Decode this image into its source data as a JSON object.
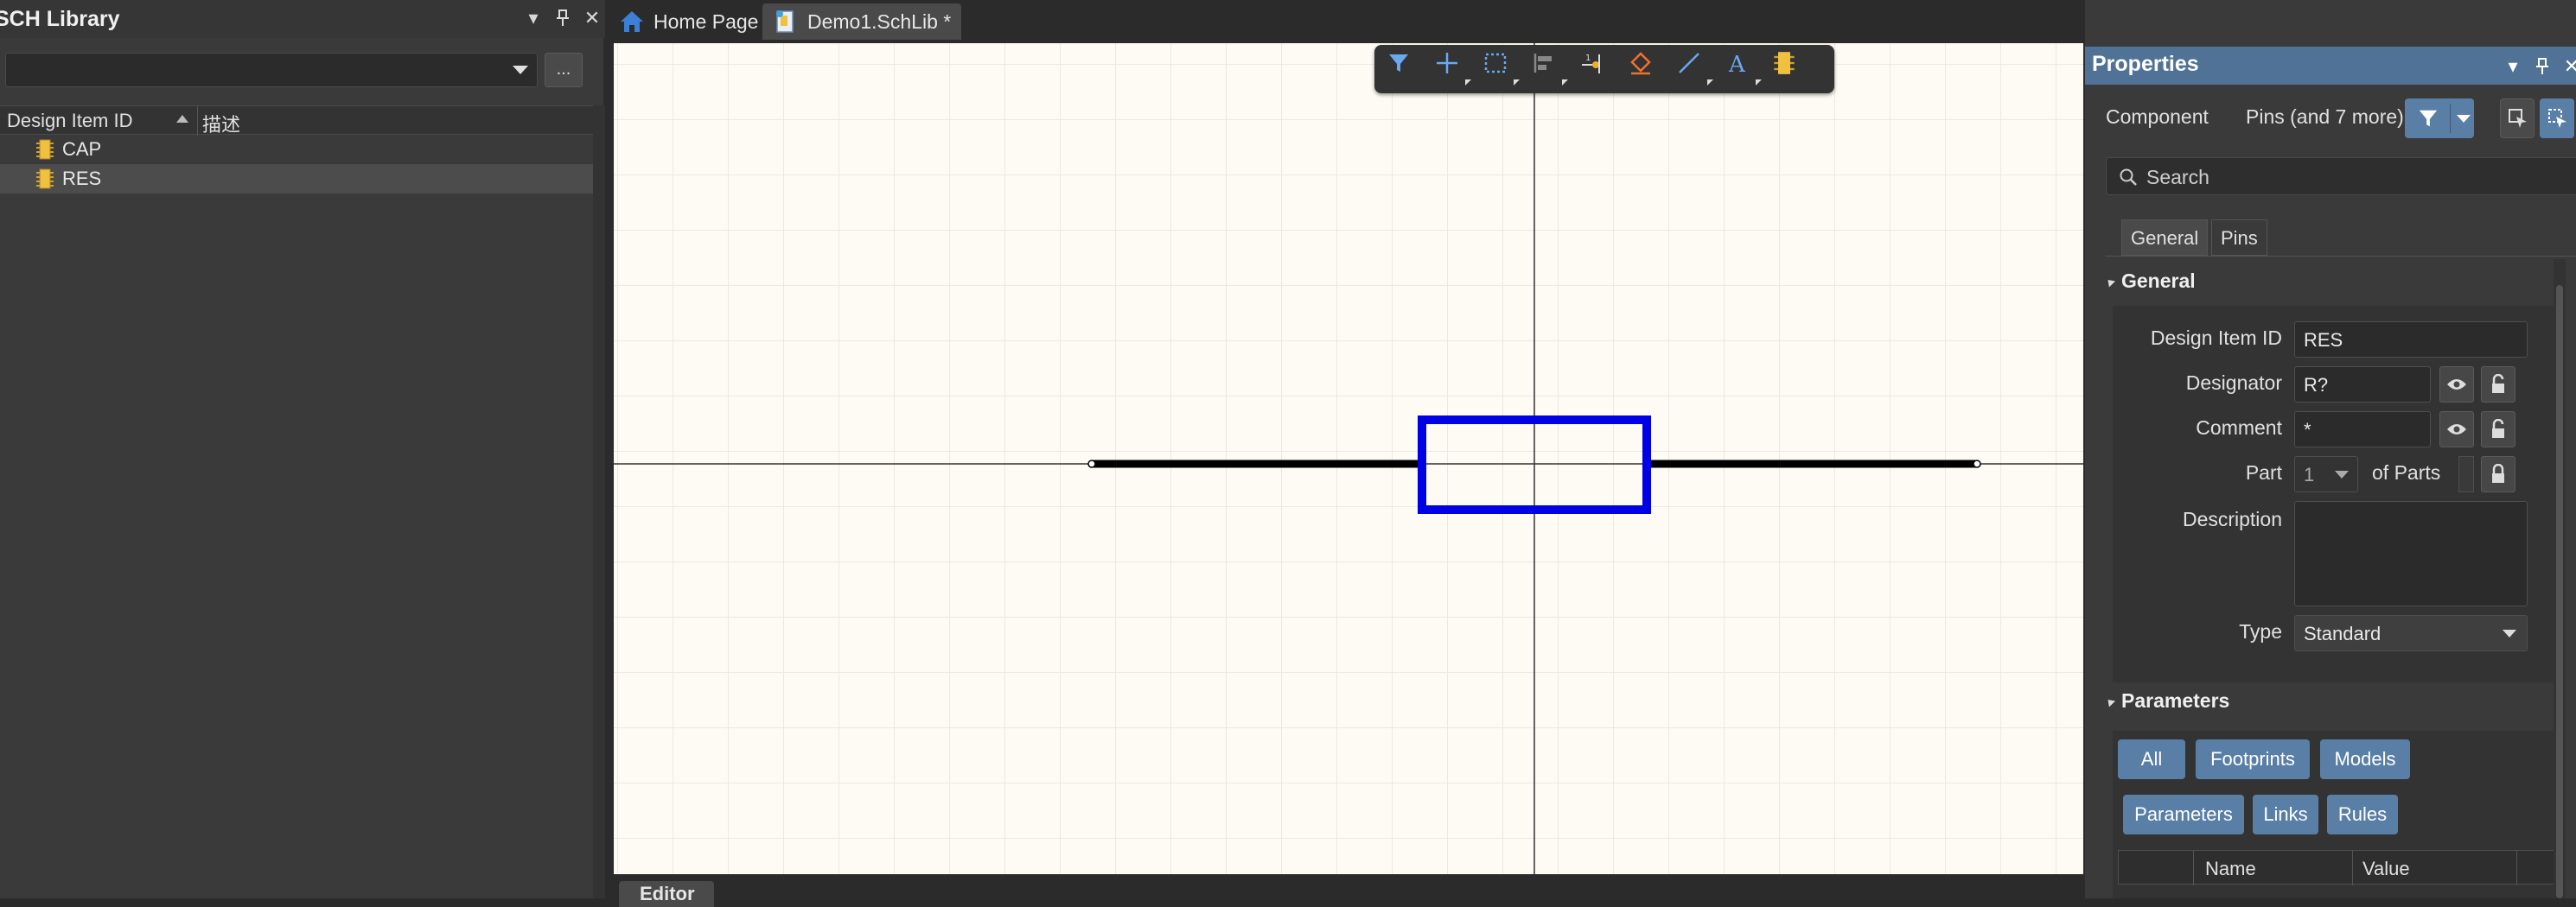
{
  "left_panel": {
    "title": "SCH Library",
    "library_select_value": "",
    "more_button_label": "...",
    "columns": [
      "Design Item ID",
      "描述"
    ],
    "items": [
      {
        "id": "CAP",
        "desc": "",
        "selected": false
      },
      {
        "id": "RES",
        "desc": "",
        "selected": true
      }
    ]
  },
  "tabs": [
    {
      "label": "Home Page",
      "icon": "home-icon",
      "active": false
    },
    {
      "label": "Demo1.SchLib *",
      "icon": "schlib-document-icon",
      "active": true
    }
  ],
  "canvas": {
    "background_color": "#fdfbf4",
    "component_body_color": "#0000e6",
    "pin_color": "#000000",
    "toolbar_icons": [
      "filter-icon",
      "move-cross-icon",
      "select-rectangle-icon",
      "align-icon",
      "place-pin-icon",
      "fill-bucket-icon",
      "line-icon",
      "text-icon",
      "component-icon"
    ]
  },
  "editor_tab": {
    "label": "Editor"
  },
  "properties": {
    "title": "Properties",
    "component_label": "Component",
    "filter_summary": "Pins (and 7 more)",
    "search_placeholder": "Search",
    "tabs": [
      "General",
      "Pins"
    ],
    "general": {
      "section_title": "General",
      "design_item_id_label": "Design Item ID",
      "design_item_id_value": "RES",
      "designator_label": "Designator",
      "designator_value": "R?",
      "comment_label": "Comment",
      "comment_value": "*",
      "part_label": "Part",
      "part_value": "1",
      "of_parts_label": "of Parts",
      "description_label": "Description",
      "description_value": "",
      "type_label": "Type",
      "type_value": "Standard"
    },
    "parameters": {
      "section_title": "Parameters",
      "filter_buttons": [
        "All",
        "Footprints",
        "Models",
        "Parameters",
        "Links",
        "Rules"
      ],
      "table_columns": [
        "Name",
        "Value"
      ]
    },
    "accent_color": "#5a7fa6"
  }
}
